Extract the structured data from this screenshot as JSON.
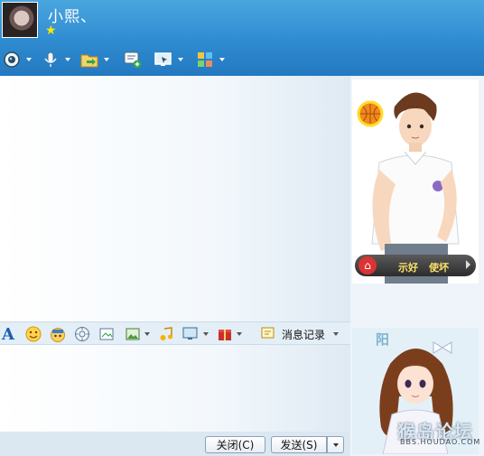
{
  "header": {
    "contact_name": "小熙、",
    "vip_icon": "star-icon",
    "colors": {
      "bar_top": "#4aa6df",
      "bar_bottom": "#2379c0"
    }
  },
  "toolbar": {
    "items": [
      {
        "icon": "video-camera-icon"
      },
      {
        "icon": "microphone-icon"
      },
      {
        "icon": "file-transfer-icon"
      },
      {
        "icon": "create-discussion-icon"
      },
      {
        "icon": "remote-assist-icon"
      },
      {
        "icon": "apps-grid-icon"
      }
    ]
  },
  "message_tools": {
    "font_icon": "font-A-icon",
    "emoji_icon": "smiley-icon",
    "magic_emoji_icon": "magic-face-icon",
    "shake_icon": "window-shake-icon",
    "screenshot_icon": "screen-capture-icon",
    "picture_icon": "picture-icon",
    "music_icon": "music-note-icon",
    "remote_icon": "monitor-icon",
    "gift_icon": "gift-box-icon",
    "history_label": "消息记录"
  },
  "buttons": {
    "close_label": "关闭(C)",
    "send_label": "发送(S)"
  },
  "show_panel": {
    "bar_labels": [
      "示好",
      "使坏"
    ],
    "bottom_art_text": "阳",
    "watermark": "猴岛论坛",
    "watermark_url": "BBS.HOUDAO.COM"
  }
}
